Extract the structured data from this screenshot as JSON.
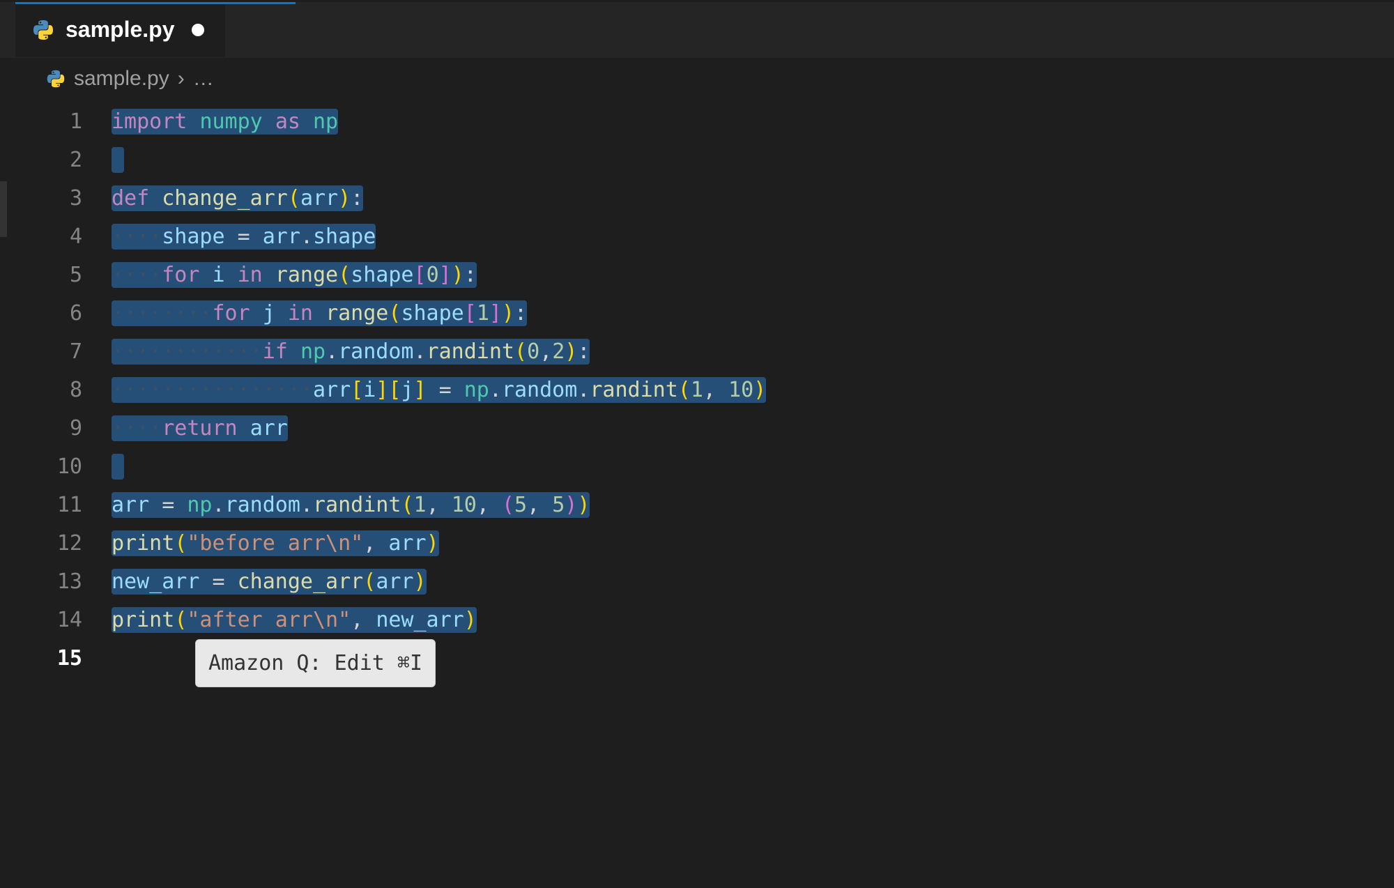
{
  "tab": {
    "filename": "sample.py",
    "dirty": true
  },
  "breadcrumb": {
    "filename": "sample.py",
    "trail": "…"
  },
  "lines": {
    "count": 15,
    "current": 15
  },
  "code": {
    "l1": {
      "kw1": "import",
      "mod": "numpy",
      "kw2": "as",
      "alias": "np"
    },
    "l3": {
      "kw": "def",
      "fn": "change_arr",
      "lp": "(",
      "param": "arr",
      "rp": ")",
      "colon": ":"
    },
    "l4": {
      "var1": "shape",
      "eq": "=",
      "var2": "arr",
      "dot": ".",
      "attr": "shape"
    },
    "l5": {
      "kw1": "for",
      "var": "i",
      "kw2": "in",
      "fn": "range",
      "lp1": "(",
      "v2": "shape",
      "lb": "[",
      "n": "0",
      "rb": "]",
      "rp1": ")",
      "colon": ":"
    },
    "l6": {
      "kw1": "for",
      "var": "j",
      "kw2": "in",
      "fn": "range",
      "lp1": "(",
      "v2": "shape",
      "lb": "[",
      "n": "1",
      "rb": "]",
      "rp1": ")",
      "colon": ":"
    },
    "l7": {
      "kw": "if",
      "mod": "np",
      "d1": ".",
      "a1": "random",
      "d2": ".",
      "fn": "randint",
      "lp": "(",
      "n1": "0",
      "c": ",",
      "n2": "2",
      "rp": ")",
      "colon": ":"
    },
    "l8": {
      "v1": "arr",
      "lb1": "[",
      "i": "i",
      "rb1": "]",
      "lb2": "[",
      "j": "j",
      "rb2": "]",
      "eq": "=",
      "mod": "np",
      "d1": ".",
      "a1": "random",
      "d2": ".",
      "fn": "randint",
      "lp": "(",
      "n1": "1",
      "c": ",",
      "n2": "10",
      "rp": ")"
    },
    "l9": {
      "kw": "return",
      "var": "arr"
    },
    "l11": {
      "v1": "arr",
      "eq": "=",
      "mod": "np",
      "d1": ".",
      "a1": "random",
      "d2": ".",
      "fn": "randint",
      "lp": "(",
      "n1": "1",
      "c1": ",",
      "n2": "10",
      "c2": ",",
      "lp2": "(",
      "n3": "5",
      "c3": ",",
      "n4": "5",
      "rp2": ")",
      "rp": ")"
    },
    "l12": {
      "fn": "print",
      "lp": "(",
      "str": "\"before arr\\n\"",
      "c": ",",
      "v": "arr",
      "rp": ")"
    },
    "l13": {
      "v1": "new_arr",
      "eq": "=",
      "fn": "change_arr",
      "lp": "(",
      "v2": "arr",
      "rp": ")"
    },
    "l14": {
      "fn": "print",
      "lp": "(",
      "str": "\"after arr\\n\"",
      "c": ",",
      "v": "new_arr",
      "rp": ")"
    }
  },
  "hint": {
    "text": "Amazon Q: Edit ⌘I"
  },
  "ws": {
    "d4": "····",
    "d8": "········",
    "d12": "············",
    "d16": "················"
  }
}
